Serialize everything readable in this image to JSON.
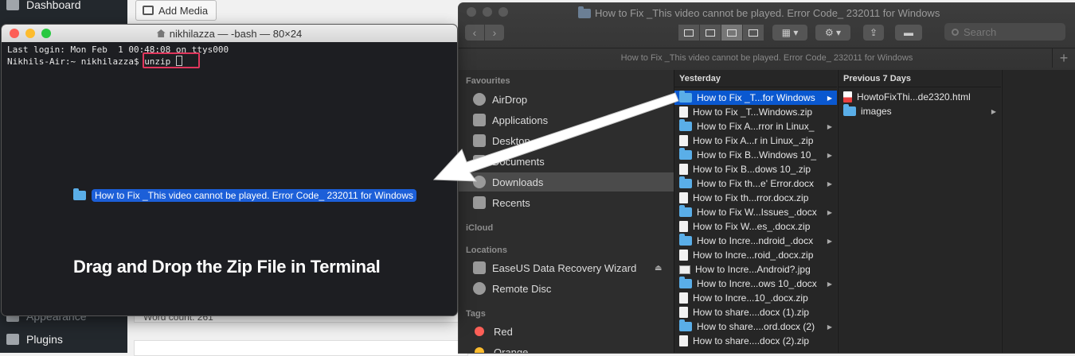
{
  "wordpress": {
    "nav_dashboard": "Dashboard",
    "nav_appearance": "Appearance",
    "nav_plugins": "Plugins",
    "add_media": "Add Media",
    "word_count": "Word count: 261"
  },
  "terminal": {
    "title": "nikhilazza — -bash — 80×24",
    "line1": "Last login: Mon Feb  1 00:48:08 on ttys000",
    "prompt": "Nikhils-Air:~ nikhilazza$ ",
    "command": "unzip",
    "dragged_item": "How to Fix _This video cannot be played. Error Code_ 232011 for Windows"
  },
  "caption": "Drag and Drop the Zip File in Terminal",
  "finder": {
    "title": "How to Fix _This video cannot be played. Error Code_ 232011 for Windows",
    "path": "How to Fix _This video cannot be played. Error Code_ 232011 for Windows",
    "search_placeholder": "Search",
    "sidebar": {
      "favourites_head": "Favourites",
      "airdrop": "AirDrop",
      "applications": "Applications",
      "desktop": "Desktop",
      "documents": "Documents",
      "downloads": "Downloads",
      "recents": "Recents",
      "icloud_head": "iCloud",
      "locations_head": "Locations",
      "easeus": "EaseUS Data Recovery Wizard",
      "remote_disc": "Remote Disc",
      "tags_head": "Tags",
      "tag_red": "Red",
      "tag_orange": "Orange"
    },
    "col1": {
      "header": "Yesterday",
      "items": [
        {
          "name": "How to Fix _T...for Windows",
          "type": "folder"
        },
        {
          "name": "How to Fix _T...Windows.zip",
          "type": "doc"
        },
        {
          "name": "How to Fix A...rror in Linux_",
          "type": "folder"
        },
        {
          "name": "How to Fix A...r in Linux_.zip",
          "type": "doc"
        },
        {
          "name": "How to Fix B...Windows 10_",
          "type": "folder"
        },
        {
          "name": "How to Fix B...dows 10_.zip",
          "type": "doc"
        },
        {
          "name": "How to Fix th...e' Error.docx",
          "type": "folder"
        },
        {
          "name": "How to Fix th...rror.docx.zip",
          "type": "doc"
        },
        {
          "name": "How to Fix W...Issues_.docx",
          "type": "folder"
        },
        {
          "name": "How to Fix W...es_.docx.zip",
          "type": "doc"
        },
        {
          "name": "How to Incre...ndroid_.docx",
          "type": "folder"
        },
        {
          "name": "How to Incre...roid_.docx.zip",
          "type": "doc"
        },
        {
          "name": "How to Incre...Android?.jpg",
          "type": "img"
        },
        {
          "name": "How to Incre...ows 10_.docx",
          "type": "folder"
        },
        {
          "name": "How to Incre...10_.docx.zip",
          "type": "doc"
        },
        {
          "name": "How to share....docx (1).zip",
          "type": "doc"
        },
        {
          "name": "How to share....ord.docx (2)",
          "type": "folder"
        },
        {
          "name": "How to share....docx (2).zip",
          "type": "doc"
        }
      ]
    },
    "col2": {
      "header": "Previous 7 Days",
      "items": [
        {
          "name": "HowtoFixThi...de2320.html",
          "type": "html"
        },
        {
          "name": "images",
          "type": "folder"
        }
      ]
    }
  }
}
